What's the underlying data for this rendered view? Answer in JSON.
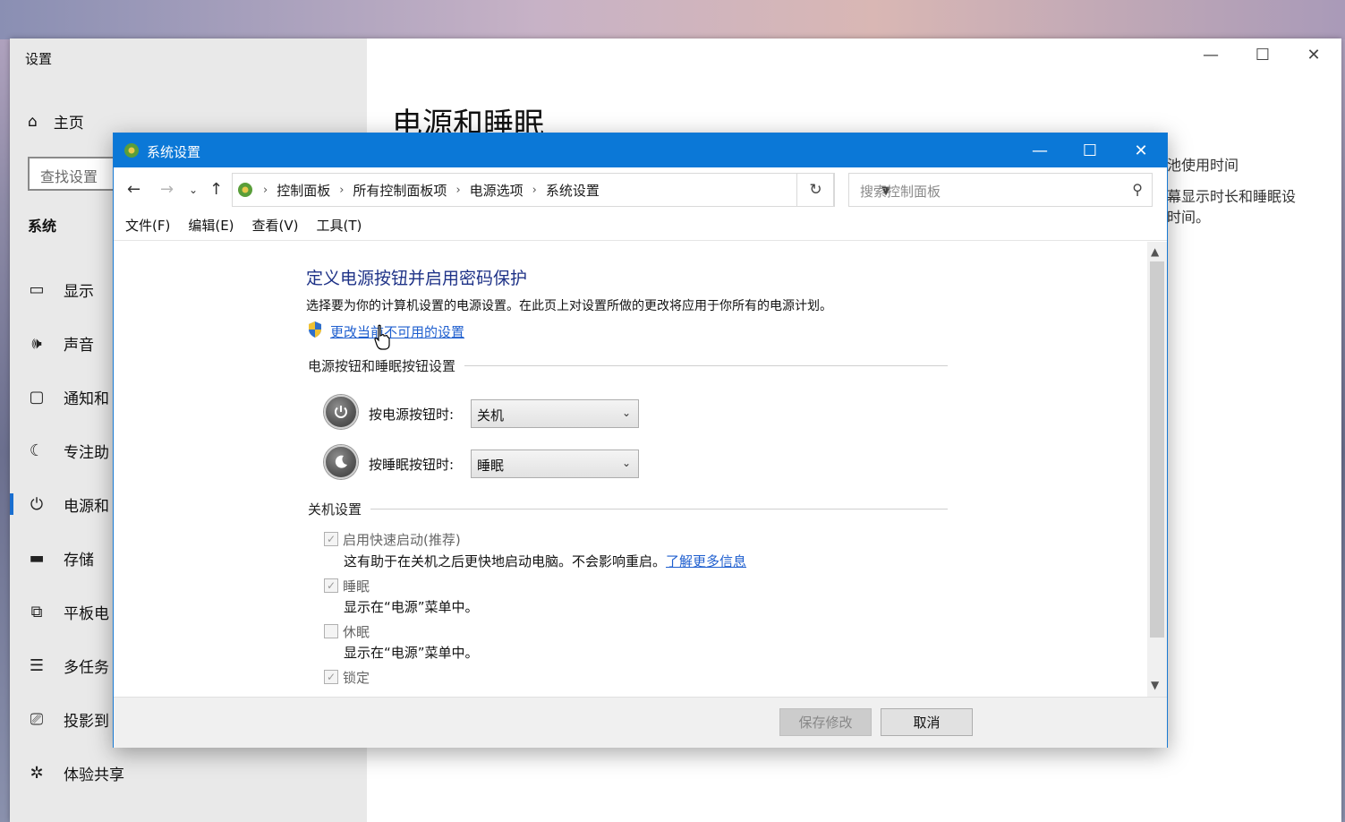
{
  "settings": {
    "title": "设置",
    "home_label": "主页",
    "search_placeholder": "查找设置",
    "section_heading": "系统",
    "nav_items": [
      {
        "label": "显示",
        "icon": "monitor-icon"
      },
      {
        "label": "声音",
        "icon": "speaker-icon"
      },
      {
        "label": "通知和",
        "icon": "notification-icon"
      },
      {
        "label": "专注助",
        "icon": "moon-icon"
      },
      {
        "label": "电源和",
        "icon": "power-icon"
      },
      {
        "label": "存储",
        "icon": "storage-icon"
      },
      {
        "label": "平板电",
        "icon": "tablet-icon"
      },
      {
        "label": "多任务",
        "icon": "multitask-icon"
      },
      {
        "label": "投影到",
        "icon": "project-icon"
      },
      {
        "label": "体验共享",
        "icon": "share-icon"
      }
    ],
    "page_title": "电源和睡眠",
    "right_text_1": "池使用时间",
    "right_text_2": "幕显示时长和睡眠设",
    "right_text_3": "时间。"
  },
  "dialog": {
    "title": "系统设置",
    "breadcrumb": [
      "控制面板",
      "所有控制面板项",
      "电源选项",
      "系统设置"
    ],
    "search_placeholder": "搜索控制面板",
    "menu": [
      "文件(F)",
      "编辑(E)",
      "查看(V)",
      "工具(T)"
    ],
    "heading": "定义电源按钮并启用密码保护",
    "description": "选择要为你的计算机设置的电源设置。在此页上对设置所做的更改将应用于你所有的电源计划。",
    "change_link": "更改当前不可用的设置",
    "button_section_label": "电源按钮和睡眠按钮设置",
    "power_button_label": "按电源按钮时:",
    "power_button_value": "关机",
    "sleep_button_label": "按睡眠按钮时:",
    "sleep_button_value": "睡眠",
    "shutdown_section_label": "关机设置",
    "options": [
      {
        "label": "启用快速启动(推荐)",
        "checked": true,
        "desc": "这有助于在关机之后更快地启动电脑。不会影响重启。",
        "link": "了解更多信息"
      },
      {
        "label": "睡眠",
        "checked": true,
        "desc": "显示在“电源”菜单中。"
      },
      {
        "label": "休眠",
        "checked": false,
        "desc": "显示在“电源”菜单中。"
      },
      {
        "label": "锁定",
        "checked": true
      }
    ],
    "save_button": "保存修改",
    "cancel_button": "取消"
  }
}
